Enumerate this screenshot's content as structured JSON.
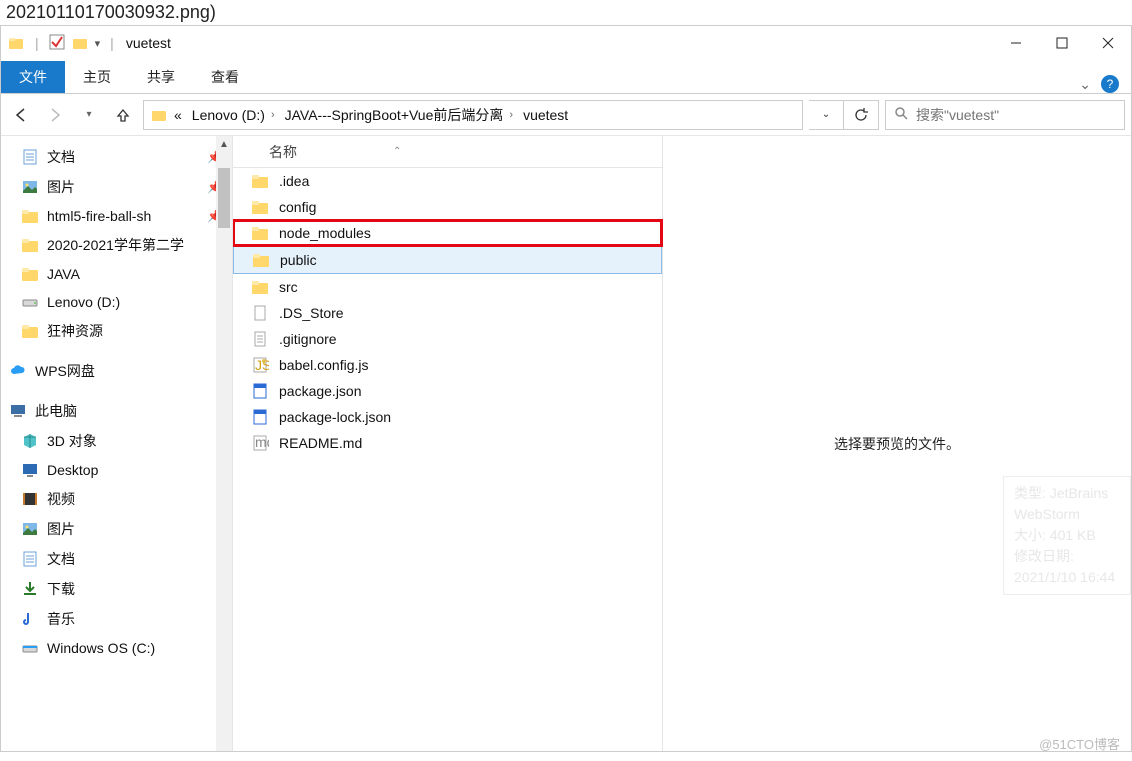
{
  "caption": "20210110170030932.png)",
  "title": "vuetest",
  "ribbon": {
    "file": "文件",
    "home": "主页",
    "share": "共享",
    "view": "查看"
  },
  "breadcrumb": {
    "overflow": "«",
    "items": [
      "Lenovo (D:)",
      "JAVA---SpringBoot+Vue前后端分离",
      "vuetest"
    ]
  },
  "search_placeholder": "搜索\"vuetest\"",
  "nav": {
    "quick": [
      {
        "label": "文档",
        "pin": true,
        "icon": "doc"
      },
      {
        "label": "图片",
        "pin": true,
        "icon": "pic"
      },
      {
        "label": "html5-fire-ball-sh",
        "pin": true,
        "icon": "folder"
      },
      {
        "label": "2020-2021学年第二学",
        "pin": false,
        "icon": "folder"
      },
      {
        "label": "JAVA",
        "pin": false,
        "icon": "folder"
      },
      {
        "label": "Lenovo (D:)",
        "pin": false,
        "icon": "drive"
      },
      {
        "label": "狂神资源",
        "pin": false,
        "icon": "folder"
      }
    ],
    "wps": "WPS网盘",
    "thispc": "此电脑",
    "pc": [
      {
        "label": "3D 对象",
        "icon": "3d"
      },
      {
        "label": "Desktop",
        "icon": "desktop"
      },
      {
        "label": "视频",
        "icon": "video"
      },
      {
        "label": "图片",
        "icon": "pic"
      },
      {
        "label": "文档",
        "icon": "doc"
      },
      {
        "label": "下载",
        "icon": "download"
      },
      {
        "label": "音乐",
        "icon": "music"
      },
      {
        "label": "Windows  OS (C:)",
        "icon": "osdrive"
      }
    ]
  },
  "col_name": "名称",
  "files": [
    {
      "name": ".idea",
      "type": "folder"
    },
    {
      "name": "config",
      "type": "folder"
    },
    {
      "name": "node_modules",
      "type": "folder",
      "highlight": true
    },
    {
      "name": "public",
      "type": "folder",
      "selected": true
    },
    {
      "name": "src",
      "type": "folder"
    },
    {
      "name": ".DS_Store",
      "type": "file"
    },
    {
      "name": ".gitignore",
      "type": "txt"
    },
    {
      "name": "babel.config.js",
      "type": "js"
    },
    {
      "name": "package.json",
      "type": "json"
    },
    {
      "name": "package-lock.json",
      "type": "json"
    },
    {
      "name": "README.md",
      "type": "md"
    }
  ],
  "preview_empty": "选择要预览的文件。",
  "tooltip": {
    "l1": "类型: JetBrains WebStorm",
    "l2": "大小: 401 KB",
    "l3": "修改日期: 2021/1/10 16:44"
  },
  "watermark": "@51CTO博客"
}
